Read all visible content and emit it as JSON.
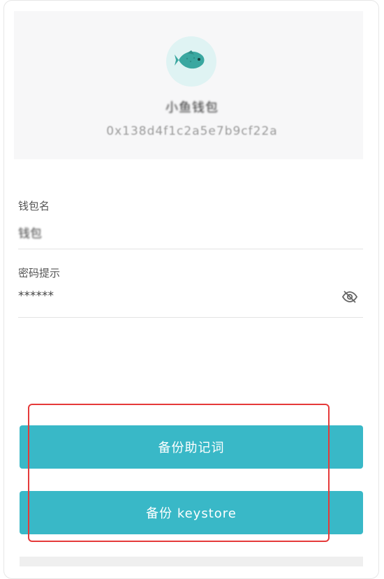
{
  "wallet": {
    "title": "小鱼钱包",
    "address": "0x138d4f1c2a5e7b9cf22a"
  },
  "fields": {
    "name_label": "钱包名",
    "name_value": "钱包",
    "hint_label": "密码提示",
    "hint_value": "******"
  },
  "buttons": {
    "backup_mnemonic": "备份助记词",
    "backup_keystore": "备份 keystore"
  },
  "colors": {
    "accent": "#39b8c7",
    "avatar_bg": "#dff3f3",
    "fish": "#3aa7a0",
    "highlight": "#e53a3a"
  },
  "icons": {
    "avatar": "fish-icon",
    "visibility": "eye-off-icon"
  }
}
